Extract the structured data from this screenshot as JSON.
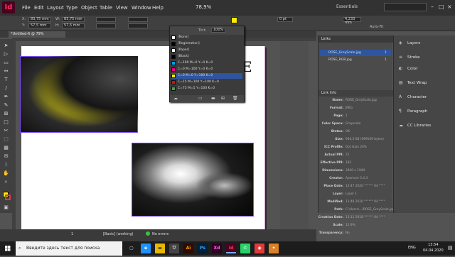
{
  "app": {
    "logo": "Id",
    "menus": [
      "File",
      "Edit",
      "Layout",
      "Type",
      "Object",
      "Table",
      "View",
      "Window",
      "Help"
    ],
    "zoom": "78,9%",
    "workspace": "Essentials"
  },
  "control": {
    "x": "83,75 mm",
    "y": "57,5 mm",
    "w": "83,75 mm",
    "h": "57,5 mm",
    "stroke": "0 pt",
    "tint": "100%",
    "measure": "4,233 mm",
    "autofit": "Auto-Fit"
  },
  "document": {
    "tab_title": "*Untitled-6 @ 79%",
    "text": "E"
  },
  "status": {
    "page": "1",
    "mode": "[Basic] (working)",
    "errors": "No errors"
  },
  "swatches": {
    "title": "Tint:",
    "items": [
      {
        "name": "[None]",
        "color": "#ffffff"
      },
      {
        "name": "[Registration]",
        "color": "#000000"
      },
      {
        "name": "[Paper]",
        "color": "#ffffff"
      },
      {
        "name": "[Black]",
        "color": "#000000"
      },
      {
        "name": "C=100 M=0 Y=0 K=0",
        "color": "#009fe3"
      },
      {
        "name": "C=0 M=100 Y=0 K=0",
        "color": "#e6007e"
      },
      {
        "name": "C=0 M=0 Y=100 K=0",
        "color": "#ffed00"
      },
      {
        "name": "C=15 M=100 Y=100 K=0",
        "color": "#c4161c"
      },
      {
        "name": "C=75 M=5 Y=100 K=0",
        "color": "#3aaa35"
      }
    ],
    "selected_index": 6
  },
  "links": {
    "title": "Links",
    "items": [
      {
        "name": "ROSE_GreyScale.jpg",
        "page": "1"
      },
      {
        "name": "ROSE_RGB.jpg",
        "page": "1"
      }
    ],
    "info_title": "Link Info",
    "info": [
      {
        "label": "Name:",
        "value": "ROSE_GreyScale.jpg"
      },
      {
        "label": "Format:",
        "value": "JPEG"
      },
      {
        "label": "Page:",
        "value": "1"
      },
      {
        "label": "Color Space:",
        "value": "Grayscale"
      },
      {
        "label": "Status:",
        "value": "OK"
      },
      {
        "label": "Size:",
        "value": "946,5 KB (969109 bytes)"
      },
      {
        "label": "ICC Profile:",
        "value": "Dot Gain 20%"
      },
      {
        "label": "Actual PPI:",
        "value": "72"
      },
      {
        "label": "Effective PPI:",
        "value": "182"
      },
      {
        "label": "Dimensions:",
        "value": "3400 x 1944"
      },
      {
        "label": "Creator:",
        "value": "Aperture 3.4.3"
      },
      {
        "label": "Place Date:",
        "value": "13:47 2020 °°°°°° 04 °°°°"
      },
      {
        "label": "Layer:",
        "value": "Layer 1"
      },
      {
        "label": "Modified:",
        "value": "13:48 2020 °°°°°° 04 °°°°"
      },
      {
        "label": "Path:",
        "value": "C:\\Users\\...\\ROSE_GreyScale.jpg"
      },
      {
        "label": "Creation Date:",
        "value": "13:11 2018 °°°°°° 04 °°°°"
      },
      {
        "label": "Scale:",
        "value": "12,9%"
      },
      {
        "label": "Transparency:",
        "value": "No"
      }
    ]
  },
  "right_panels": [
    {
      "label": "Layers",
      "icon": "layers-icon"
    },
    {
      "label": "Stroke",
      "icon": "stroke-icon"
    },
    {
      "label": "Color",
      "icon": "color-icon"
    },
    {
      "label": "Text Wrap",
      "icon": "text-wrap-icon"
    },
    {
      "label": "Character",
      "icon": "character-icon"
    },
    {
      "label": "Paragraph",
      "icon": "paragraph-icon"
    },
    {
      "label": "CC Libraries",
      "icon": "cc-libraries-icon"
    }
  ],
  "taskbar": {
    "search_placeholder": "Введите здесь текст для поиска",
    "lang": "ENG",
    "time": "13:54",
    "date": "04.04.2020"
  }
}
